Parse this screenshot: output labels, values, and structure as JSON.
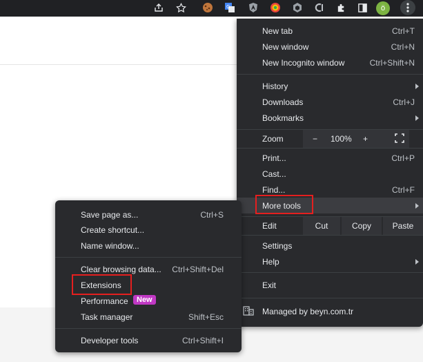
{
  "toolbar": {
    "icons": [
      "share-icon",
      "bookmark-star-icon",
      "cookie-extension-icon",
      "translate-extension-icon",
      "angular-extension-icon",
      "colorzilla-extension-icon",
      "dark-extension-icon",
      "c-extension-icon",
      "extensions-puzzle-icon",
      "sidepanel-icon"
    ],
    "avatar_letter": "ö"
  },
  "main_menu": {
    "new_tab": {
      "label": "New tab",
      "shortcut": "Ctrl+T"
    },
    "new_window": {
      "label": "New window",
      "shortcut": "Ctrl+N"
    },
    "new_incognito": {
      "label": "New Incognito window",
      "shortcut": "Ctrl+Shift+N"
    },
    "history": {
      "label": "History"
    },
    "downloads": {
      "label": "Downloads",
      "shortcut": "Ctrl+J"
    },
    "bookmarks": {
      "label": "Bookmarks"
    },
    "zoom": {
      "label": "Zoom",
      "minus": "−",
      "value": "100%",
      "plus": "+"
    },
    "print": {
      "label": "Print...",
      "shortcut": "Ctrl+P"
    },
    "cast": {
      "label": "Cast..."
    },
    "find": {
      "label": "Find...",
      "shortcut": "Ctrl+F"
    },
    "more_tools": {
      "label": "More tools"
    },
    "edit": {
      "label": "Edit",
      "cut": "Cut",
      "copy": "Copy",
      "paste": "Paste"
    },
    "settings": {
      "label": "Settings"
    },
    "help": {
      "label": "Help"
    },
    "exit": {
      "label": "Exit"
    },
    "managed": {
      "label": "Managed by beyn.com.tr"
    }
  },
  "sub_menu": {
    "save_page": {
      "label": "Save page as...",
      "shortcut": "Ctrl+S"
    },
    "create_shortcut": {
      "label": "Create shortcut..."
    },
    "name_window": {
      "label": "Name window..."
    },
    "clear_browsing": {
      "label": "Clear browsing data...",
      "shortcut": "Ctrl+Shift+Del"
    },
    "extensions": {
      "label": "Extensions"
    },
    "performance": {
      "label": "Performance",
      "badge": "New"
    },
    "task_manager": {
      "label": "Task manager",
      "shortcut": "Shift+Esc"
    },
    "developer_tools": {
      "label": "Developer tools",
      "shortcut": "Ctrl+Shift+I"
    }
  },
  "colors": {
    "menu_bg": "#292a2d",
    "highlight": "#e51f1f",
    "badge": "#c038c4"
  }
}
